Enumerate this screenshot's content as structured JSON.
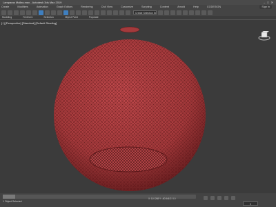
{
  "window": {
    "title": "Lamparas Mallas.max - Autodesk 3ds Max 2019",
    "controls": [
      "–",
      "□",
      "✕"
    ]
  },
  "menu": {
    "items": [
      "Create",
      "Modifiers",
      "Animation",
      "Graph Editors",
      "Rendering",
      "Civil View",
      "Customize",
      "Scripting",
      "Content",
      "Arnold",
      "Help",
      "CGDESIGN"
    ],
    "sign_in": "Sign in"
  },
  "toolbar": {
    "selection_set_placeholder": "Create Selection Se"
  },
  "ribbon": {
    "items": [
      "Modeling",
      "Freeform",
      "Selection",
      "Object Paint",
      "Populate"
    ]
  },
  "viewport": {
    "label": "[+] [Perspective] [Standard] [Default Shading]",
    "object_color": "#a8393b",
    "wire_color": "#6e1f22"
  },
  "status": {
    "text": "1 Object Selected",
    "coords": "X: 110.268   Y: -60.546   Z: 0.0",
    "frame": "0",
    "timeline": "0 / 100"
  }
}
